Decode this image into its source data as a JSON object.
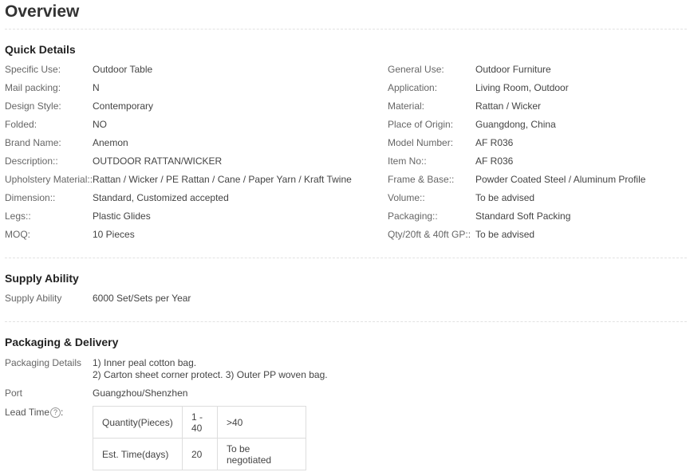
{
  "title": "Overview",
  "quick_details": {
    "heading": "Quick Details",
    "left": [
      {
        "label": "Specific Use:",
        "value": "Outdoor Table"
      },
      {
        "label": "Mail packing:",
        "value": "N"
      },
      {
        "label": "Design Style:",
        "value": "Contemporary"
      },
      {
        "label": "Folded:",
        "value": "NO"
      },
      {
        "label": "Brand Name:",
        "value": "Anemon"
      },
      {
        "label": "Description::",
        "value": "OUTDOOR RATTAN/WICKER"
      },
      {
        "label": "Upholstery Material::",
        "value": "Rattan / Wicker / PE Rattan / Cane / Paper Yarn / Kraft Twine"
      },
      {
        "label": "Dimension::",
        "value": "Standard, Customized accepted"
      },
      {
        "label": "Legs::",
        "value": "Plastic Glides"
      },
      {
        "label": "MOQ:",
        "value": "10 Pieces"
      }
    ],
    "right": [
      {
        "label": "General Use:",
        "value": "Outdoor Furniture"
      },
      {
        "label": "Application:",
        "value": "Living Room, Outdoor"
      },
      {
        "label": "Material:",
        "value": "Rattan / Wicker"
      },
      {
        "label": "Place of Origin:",
        "value": "Guangdong, China"
      },
      {
        "label": "Model Number:",
        "value": "AF R036"
      },
      {
        "label": "Item No::",
        "value": "AF R036"
      },
      {
        "label": "Frame & Base::",
        "value": "Powder Coated Steel / Aluminum Profile"
      },
      {
        "label": "Volume::",
        "value": "To be advised"
      },
      {
        "label": "Packaging::",
        "value": "Standard Soft Packing"
      },
      {
        "label": "Qty/20ft & 40ft GP::",
        "value": "To be advised"
      }
    ]
  },
  "supply": {
    "heading": "Supply Ability",
    "label": "Supply Ability",
    "value": "6000 Set/Sets per Year"
  },
  "packaging": {
    "heading": "Packaging & Delivery",
    "details_label": "Packaging Details",
    "details_line1": "1) Inner peal cotton bag.",
    "details_line2": "2) Carton sheet corner protect. 3) Outer PP woven bag.",
    "port_label": "Port",
    "port_value": "Guangzhou/Shenzhen",
    "lead_label": "Lead Time",
    "help_glyph": "?",
    "lead_table": {
      "row1": [
        "Quantity(Pieces)",
        "1 - 40",
        ">40"
      ],
      "row2": [
        "Est. Time(days)",
        "20",
        "To be negotiated"
      ]
    }
  }
}
